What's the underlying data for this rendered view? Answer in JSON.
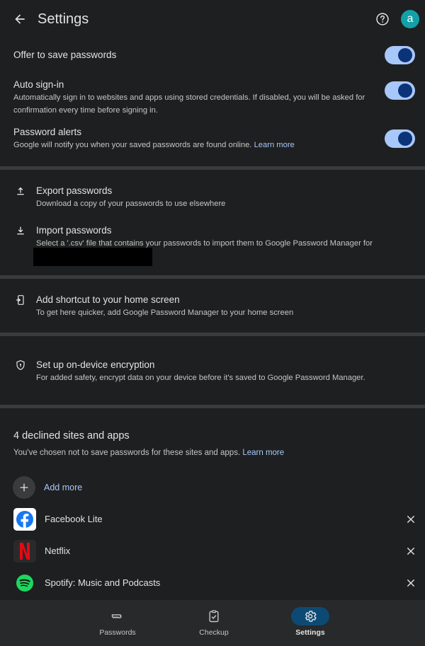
{
  "header": {
    "title": "Settings",
    "avatar_letter": "a"
  },
  "toggles": [
    {
      "title": "Offer to save passwords",
      "desc": "",
      "on": true
    },
    {
      "title": "Auto sign-in",
      "desc": "Automatically sign in to websites and apps using stored credentials. If disabled, you will be asked for confirmation every time before signing in.",
      "on": true
    },
    {
      "title": "Password alerts",
      "desc": "Google will notify you when your saved passwords are found online.",
      "link": "Learn more",
      "on": true
    }
  ],
  "actions": {
    "export": {
      "title": "Export passwords",
      "desc": "Download a copy of your passwords to use elsewhere"
    },
    "import": {
      "title": "Import passwords",
      "desc": "Select a '.csv' file that contains your passwords to import them to Google Password Manager for"
    },
    "shortcut": {
      "title": "Add shortcut to your home screen",
      "desc": "To get here quicker, add Google Password Manager to your home screen"
    },
    "encryption": {
      "title": "Set up on-device encryption",
      "desc": "For added safety, encrypt data on your device before it's saved to Google Password Manager."
    }
  },
  "declined": {
    "title": "4 declined sites and apps",
    "desc": "You've chosen not to save passwords for these sites and apps.",
    "link": "Learn more",
    "add_more": "Add more",
    "sites": [
      {
        "name": "Facebook Lite",
        "icon": "facebook-icon"
      },
      {
        "name": "Netflix",
        "icon": "netflix-icon"
      },
      {
        "name": "Spotify: Music and Podcasts",
        "icon": "spotify-icon"
      }
    ]
  },
  "nav": {
    "items": [
      {
        "label": "Passwords",
        "icon": "key-icon",
        "active": false
      },
      {
        "label": "Checkup",
        "icon": "clipboard-check-icon",
        "active": false
      },
      {
        "label": "Settings",
        "icon": "gear-icon",
        "active": true
      }
    ]
  },
  "colors": {
    "background": "#1e1f20",
    "accent": "#a8c7fa",
    "toggle_knob": "#0a3378",
    "avatar": "#12a1a8",
    "nav_active": "#0d4a73"
  }
}
